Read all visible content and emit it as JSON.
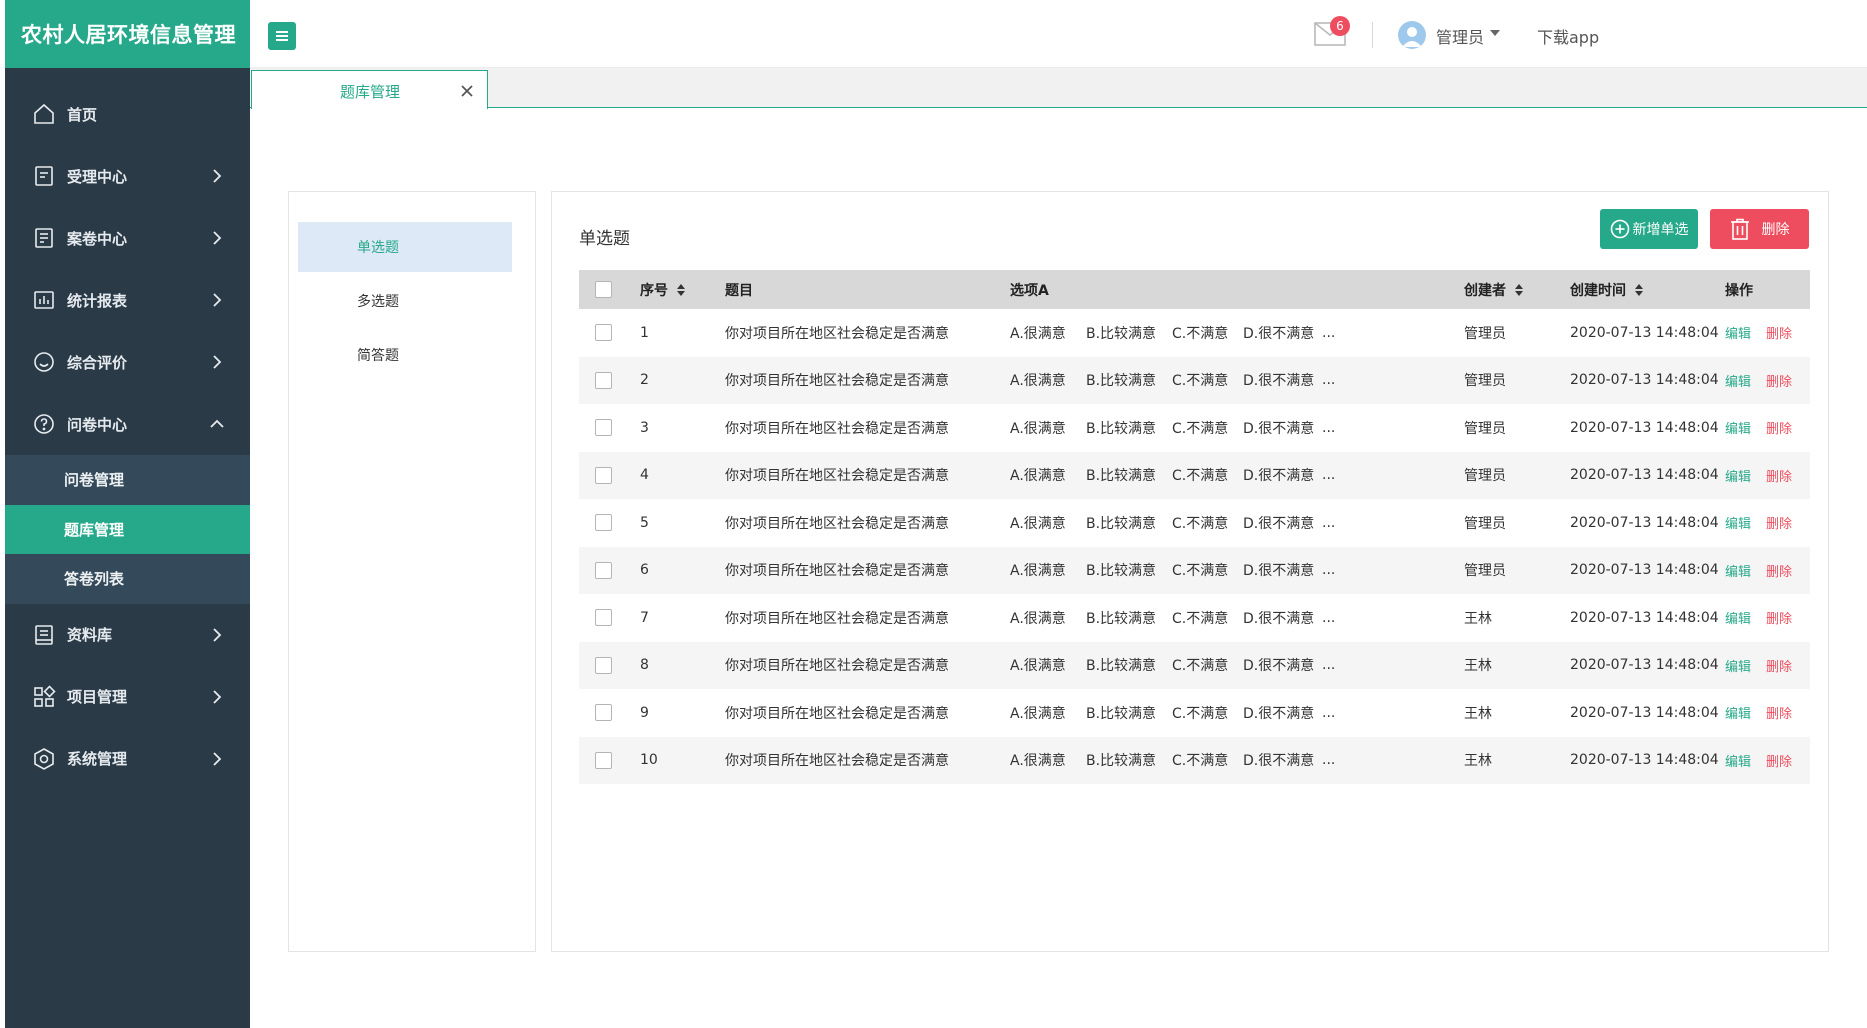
{
  "app": {
    "title": "农村人居环境信息管理"
  },
  "sidebar": {
    "items": [
      {
        "label": "首页",
        "icon": "home-icon"
      },
      {
        "label": "受理中心",
        "icon": "document-icon"
      },
      {
        "label": "案卷中心",
        "icon": "file-icon"
      },
      {
        "label": "统计报表",
        "icon": "bar-chart-icon"
      },
      {
        "label": "综合评价",
        "icon": "smile-icon"
      },
      {
        "label": "问卷中心",
        "icon": "question-circle-icon",
        "expanded": true
      },
      {
        "label": "资料库",
        "icon": "library-icon"
      },
      {
        "label": "项目管理",
        "icon": "grid-icon"
      },
      {
        "label": "系统管理",
        "icon": "settings-hexagon-icon"
      }
    ],
    "submenu": [
      {
        "label": "问卷管理"
      },
      {
        "label": "题库管理",
        "active": true
      },
      {
        "label": "答卷列表"
      }
    ]
  },
  "header": {
    "mail_badge": "6",
    "user_name": "管理员",
    "download_label": "下载app"
  },
  "tabs": [
    {
      "label": "题库管理"
    }
  ],
  "categories": [
    {
      "label": "单选题",
      "active": true
    },
    {
      "label": "多选题"
    },
    {
      "label": "简答题"
    }
  ],
  "panel": {
    "title": "单选题",
    "add_button": "新增单选",
    "delete_button": "删除"
  },
  "table": {
    "headers": {
      "index": "序号",
      "title": "题目",
      "option_a": "选项A",
      "creator": "创建者",
      "created_at": "创建时间",
      "actions": "操作"
    },
    "edit_label": "编辑",
    "delete_label": "删除",
    "rows": [
      {
        "index": "1",
        "title": "你对项目所在地区社会稳定是否满意",
        "a": "A.很满意",
        "b": "B.比较满意",
        "c": "C.不满意",
        "d": "D.很不满意",
        "more": "...",
        "creator": "管理员",
        "time": "2020-07-13 14:48:04"
      },
      {
        "index": "2",
        "title": "你对项目所在地区社会稳定是否满意",
        "a": "A.很满意",
        "b": "B.比较满意",
        "c": "C.不满意",
        "d": "D.很不满意",
        "more": "...",
        "creator": "管理员",
        "time": "2020-07-13 14:48:04"
      },
      {
        "index": "3",
        "title": "你对项目所在地区社会稳定是否满意",
        "a": "A.很满意",
        "b": "B.比较满意",
        "c": "C.不满意",
        "d": "D.很不满意",
        "more": "...",
        "creator": "管理员",
        "time": "2020-07-13 14:48:04"
      },
      {
        "index": "4",
        "title": "你对项目所在地区社会稳定是否满意",
        "a": "A.很满意",
        "b": "B.比较满意",
        "c": "C.不满意",
        "d": "D.很不满意",
        "more": "...",
        "creator": "管理员",
        "time": "2020-07-13 14:48:04"
      },
      {
        "index": "5",
        "title": "你对项目所在地区社会稳定是否满意",
        "a": "A.很满意",
        "b": "B.比较满意",
        "c": "C.不满意",
        "d": "D.很不满意",
        "more": "...",
        "creator": "管理员",
        "time": "2020-07-13 14:48:04"
      },
      {
        "index": "6",
        "title": "你对项目所在地区社会稳定是否满意",
        "a": "A.很满意",
        "b": "B.比较满意",
        "c": "C.不满意",
        "d": "D.很不满意",
        "more": "...",
        "creator": "管理员",
        "time": "2020-07-13 14:48:04"
      },
      {
        "index": "7",
        "title": "你对项目所在地区社会稳定是否满意",
        "a": "A.很满意",
        "b": "B.比较满意",
        "c": "C.不满意",
        "d": "D.很不满意",
        "more": "...",
        "creator": "王林",
        "time": "2020-07-13 14:48:04"
      },
      {
        "index": "8",
        "title": "你对项目所在地区社会稳定是否满意",
        "a": "A.很满意",
        "b": "B.比较满意",
        "c": "C.不满意",
        "d": "D.很不满意",
        "more": "...",
        "creator": "王林",
        "time": "2020-07-13 14:48:04"
      },
      {
        "index": "9",
        "title": "你对项目所在地区社会稳定是否满意",
        "a": "A.很满意",
        "b": "B.比较满意",
        "c": "C.不满意",
        "d": "D.很不满意",
        "more": "...",
        "creator": "王林",
        "time": "2020-07-13 14:48:04"
      },
      {
        "index": "10",
        "title": "你对项目所在地区社会稳定是否满意",
        "a": "A.很满意",
        "b": "B.比较满意",
        "c": "C.不满意",
        "d": "D.很不满意",
        "more": "...",
        "creator": "王林",
        "time": "2020-07-13 14:48:04"
      }
    ]
  },
  "colors": {
    "brand": "#26a98a",
    "danger": "#ed4d5e",
    "sidebar": "#2b3a47"
  }
}
